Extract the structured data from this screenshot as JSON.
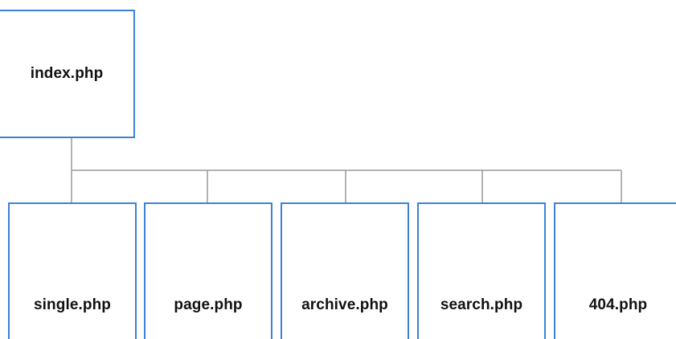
{
  "diagram": {
    "root": {
      "label": "index.php"
    },
    "children": [
      {
        "label": "single.php"
      },
      {
        "label": "page.php"
      },
      {
        "label": "archive.php"
      },
      {
        "label": "search.php"
      },
      {
        "label": "404.php"
      }
    ]
  },
  "colors": {
    "node_border": "#3b82d6",
    "connector": "#999999",
    "text": "#111111",
    "background": "#ffffff"
  }
}
